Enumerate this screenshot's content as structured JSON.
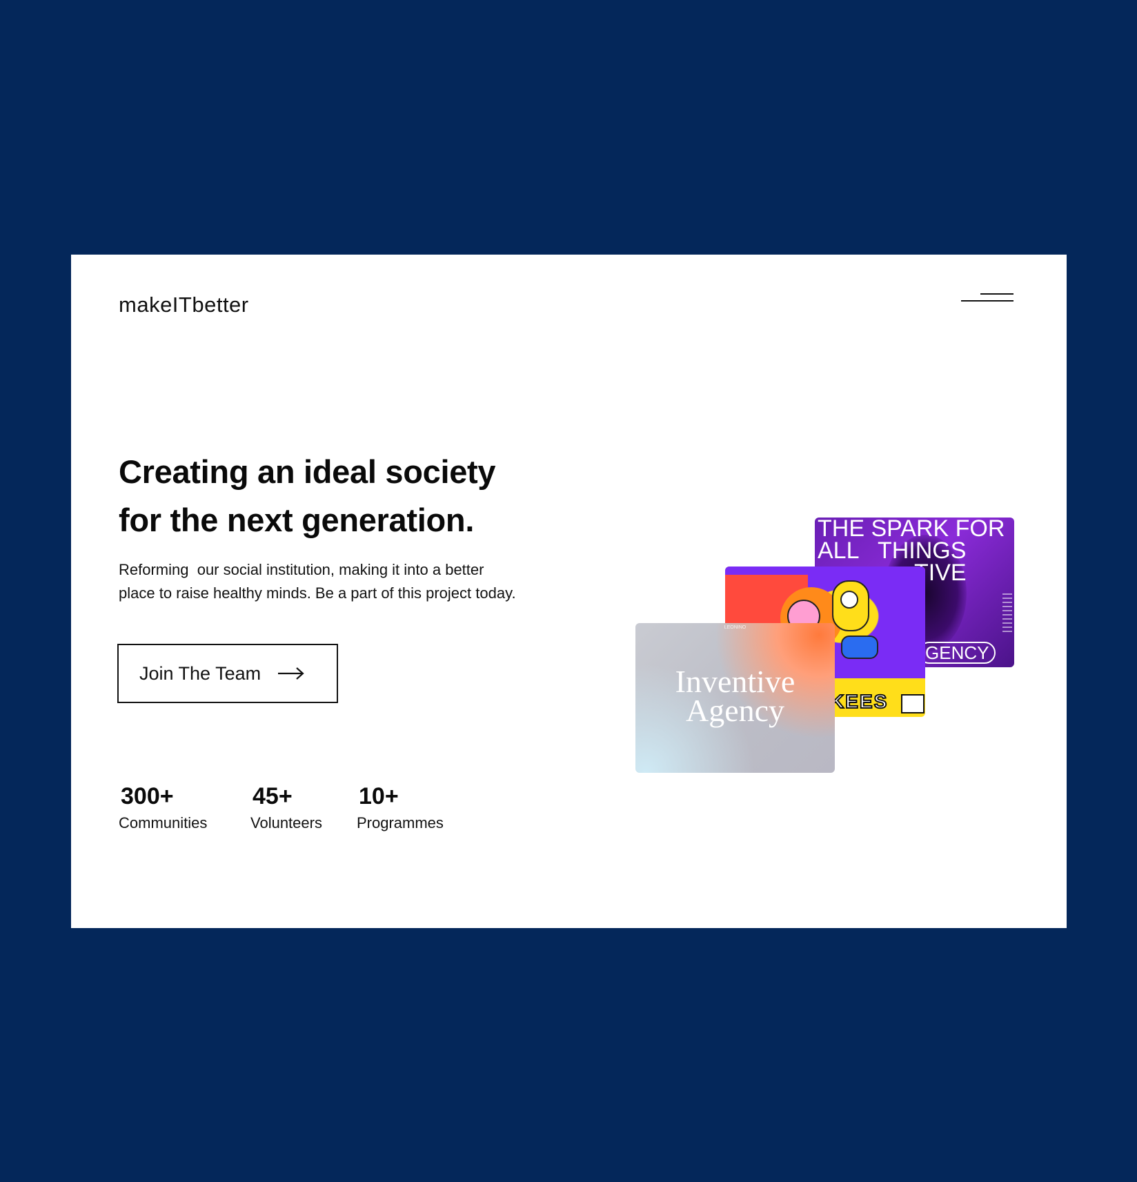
{
  "header": {
    "logo": "makeITbetter",
    "menu_icon": "menu-icon"
  },
  "hero": {
    "headline_line1": "Creating an ideal society",
    "headline_line2": "for the next generation.",
    "subline_line1": "Reforming  our social institution, making it into a better",
    "subline_line2": "place to raise healthy minds. Be a part of this project today.",
    "cta_label": "Join The Team",
    "cta_icon": "arrow-right-icon"
  },
  "stats": [
    {
      "value": "300+",
      "label": "Communities"
    },
    {
      "value": "45+",
      "label": "Volunteers"
    },
    {
      "value": "10+",
      "label": "Programmes"
    }
  ],
  "showcase": {
    "purple_line1": "THE SPARK FOR",
    "purple_line2": "ALL   THINGS",
    "purple_line3": "TIVE",
    "purple_pill": "GENCY",
    "colorful_word": "KEES",
    "gradient_top": "LEONINO",
    "gradient_title_line1": "Inventive",
    "gradient_title_line2": "Agency"
  },
  "colors": {
    "background": "#04275a",
    "card": "#ffffff",
    "text": "#0a0a0a"
  }
}
